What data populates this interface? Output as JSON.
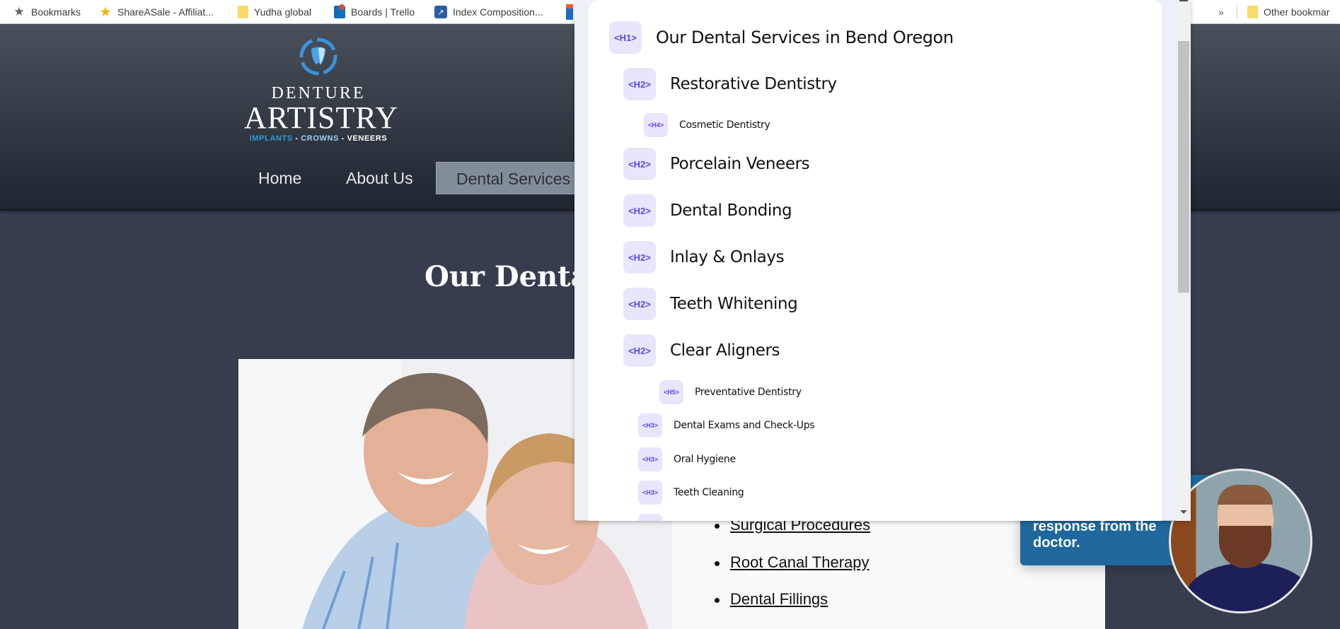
{
  "bookmarks_bar": {
    "items": [
      {
        "label": "Bookmarks",
        "icon": "star-icon"
      },
      {
        "label": "ShareASale - Affiliat...",
        "icon": "sharesale-star-icon"
      },
      {
        "label": "Yudha global",
        "icon": "folder-icon"
      },
      {
        "label": "Boards | Trello",
        "icon": "trello-icon"
      },
      {
        "label": "Index Composition...",
        "icon": "chart-icon"
      }
    ],
    "overflow_label": "»",
    "other_bookmarks_label": "Other bookmar"
  },
  "site": {
    "logo": {
      "line1": "DENTURE",
      "line2": "ARTISTRY",
      "tag_implants": "IMPLANTS",
      "tag_sep1": " - ",
      "tag_crowns": "CROWNS",
      "tag_sep2": " - ",
      "tag_veneers": "VENEERS"
    },
    "nav": [
      {
        "label": "Home",
        "active": false
      },
      {
        "label": "About Us",
        "active": false
      },
      {
        "label": "Dental Services",
        "active": true
      }
    ],
    "page_title": "Our Dental",
    "service_links": [
      "Surgical Procedures",
      "Root Canal Therapy",
      "Dental Fillings"
    ],
    "chat": {
      "bubble_text_line1": "response from the",
      "bubble_text_line2": "doctor."
    }
  },
  "heading_outline": {
    "headings": [
      {
        "tag": "<H1>",
        "text": "Our Dental Services in Bend Oregon"
      },
      {
        "tag": "<H2>",
        "text": "Restorative Dentistry"
      },
      {
        "tag": "<H4>",
        "text": "Cosmetic Dentistry"
      },
      {
        "tag": "<H2>",
        "text": "Porcelain Veneers"
      },
      {
        "tag": "<H2>",
        "text": "Dental Bonding"
      },
      {
        "tag": "<H2>",
        "text": "Inlay & Onlays"
      },
      {
        "tag": "<H2>",
        "text": "Teeth Whitening"
      },
      {
        "tag": "<H2>",
        "text": "Clear Aligners"
      },
      {
        "tag": "<H5>",
        "text": "Preventative Dentistry"
      },
      {
        "tag": "<H3>",
        "text": "Dental Exams and Check-Ups"
      },
      {
        "tag": "<H3>",
        "text": "Oral Hygiene"
      },
      {
        "tag": "<H3>",
        "text": "Teeth Cleaning"
      }
    ]
  },
  "colors": {
    "page_bg": "#373c4f",
    "tag_bg": "#e8e6fd",
    "tag_text": "#5a45f0",
    "chat_blue": "#1f679c",
    "logo_blue": "#2e9ae0"
  }
}
